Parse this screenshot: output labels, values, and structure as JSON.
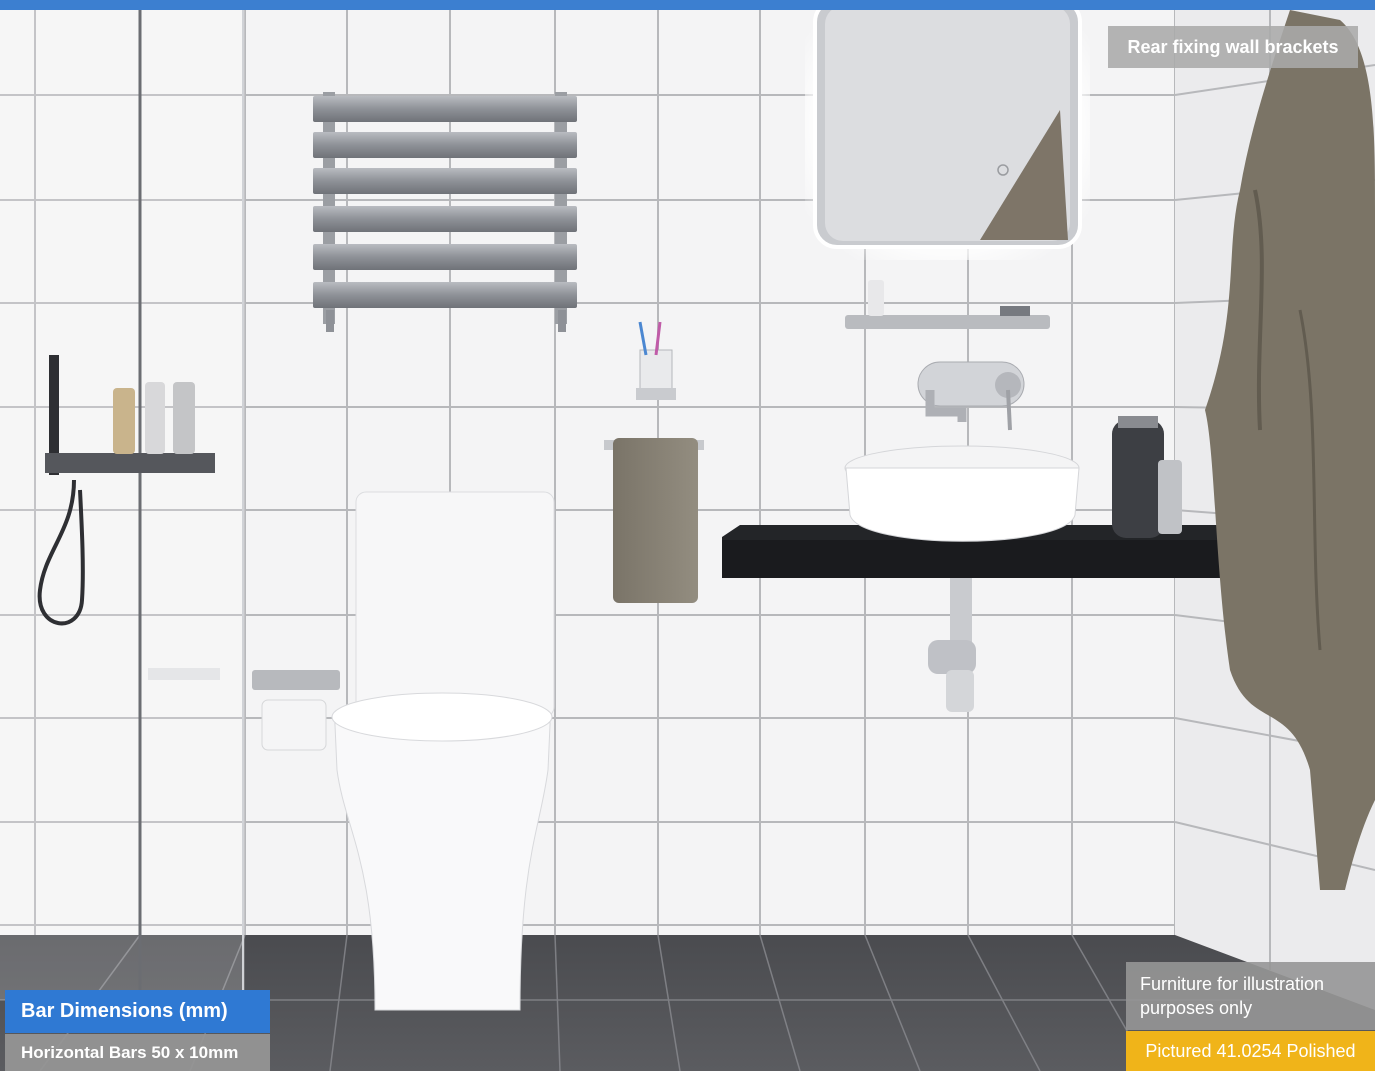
{
  "labels": {
    "rear_fixing": "Rear fixing wall brackets",
    "bar_dimensions_title": "Bar Dimensions (mm)",
    "horizontal_bars": "Horizontal Bars 50 x 10mm",
    "furniture_note": "Furniture for illustration purposes only",
    "pictured": "Pictured 41.0254 Polished"
  },
  "colors": {
    "accent_blue": "#2f79d3",
    "accent_yellow": "#f0b419",
    "label_grey": "#9a9a9a"
  }
}
